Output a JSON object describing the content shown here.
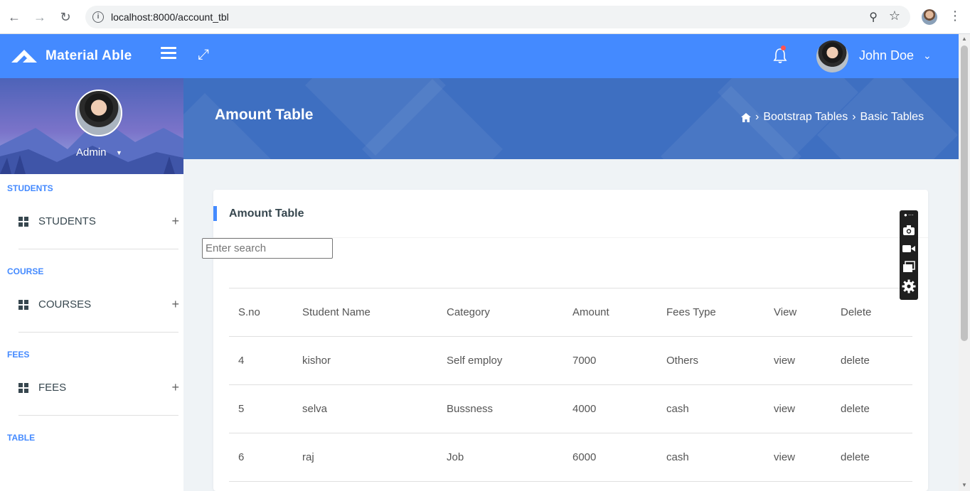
{
  "browser": {
    "url": "localhost:8000/account_tbl"
  },
  "header": {
    "app_name": "Material Able",
    "user_name": "John Doe"
  },
  "sidebar": {
    "profile_label": "Admin",
    "sections": [
      {
        "heading": "STUDENTS",
        "item": "STUDENTS"
      },
      {
        "heading": "COURSE",
        "item": "COURSES"
      },
      {
        "heading": "FEES",
        "item": "FEES"
      },
      {
        "heading": "TABLE"
      }
    ]
  },
  "banner": {
    "title": "Amount Table",
    "breadcrumb": [
      "Bootstrap Tables",
      "Basic Tables"
    ]
  },
  "card": {
    "title": "Amount Table",
    "search_placeholder": "Enter search"
  },
  "table": {
    "columns": [
      "S.no",
      "Student Name",
      "Category",
      "Amount",
      "Fees Type",
      "View",
      "Delete"
    ],
    "rows": [
      [
        "4",
        "kishor",
        "Self employ",
        "7000",
        "Others",
        "view",
        "delete"
      ],
      [
        "5",
        "selva",
        "Bussness",
        "4000",
        "cash",
        "view",
        "delete"
      ],
      [
        "6",
        "raj",
        "Job",
        "6000",
        "cash",
        "view",
        "delete"
      ]
    ]
  },
  "colors": {
    "primary": "#448aff",
    "banner": "#3e6fc1",
    "background": "#eff3f6"
  },
  "icons": [
    "back-icon",
    "forward-icon",
    "reload-icon",
    "info-icon",
    "zoom-icon",
    "star-icon",
    "kebab-menu-icon",
    "logo-icon",
    "hamburger-icon",
    "fullscreen-icon",
    "bell-icon",
    "chevron-down-icon",
    "grid-icon",
    "plus-icon",
    "home-icon",
    "camera-icon",
    "video-icon",
    "window-icon",
    "gear-icon"
  ]
}
